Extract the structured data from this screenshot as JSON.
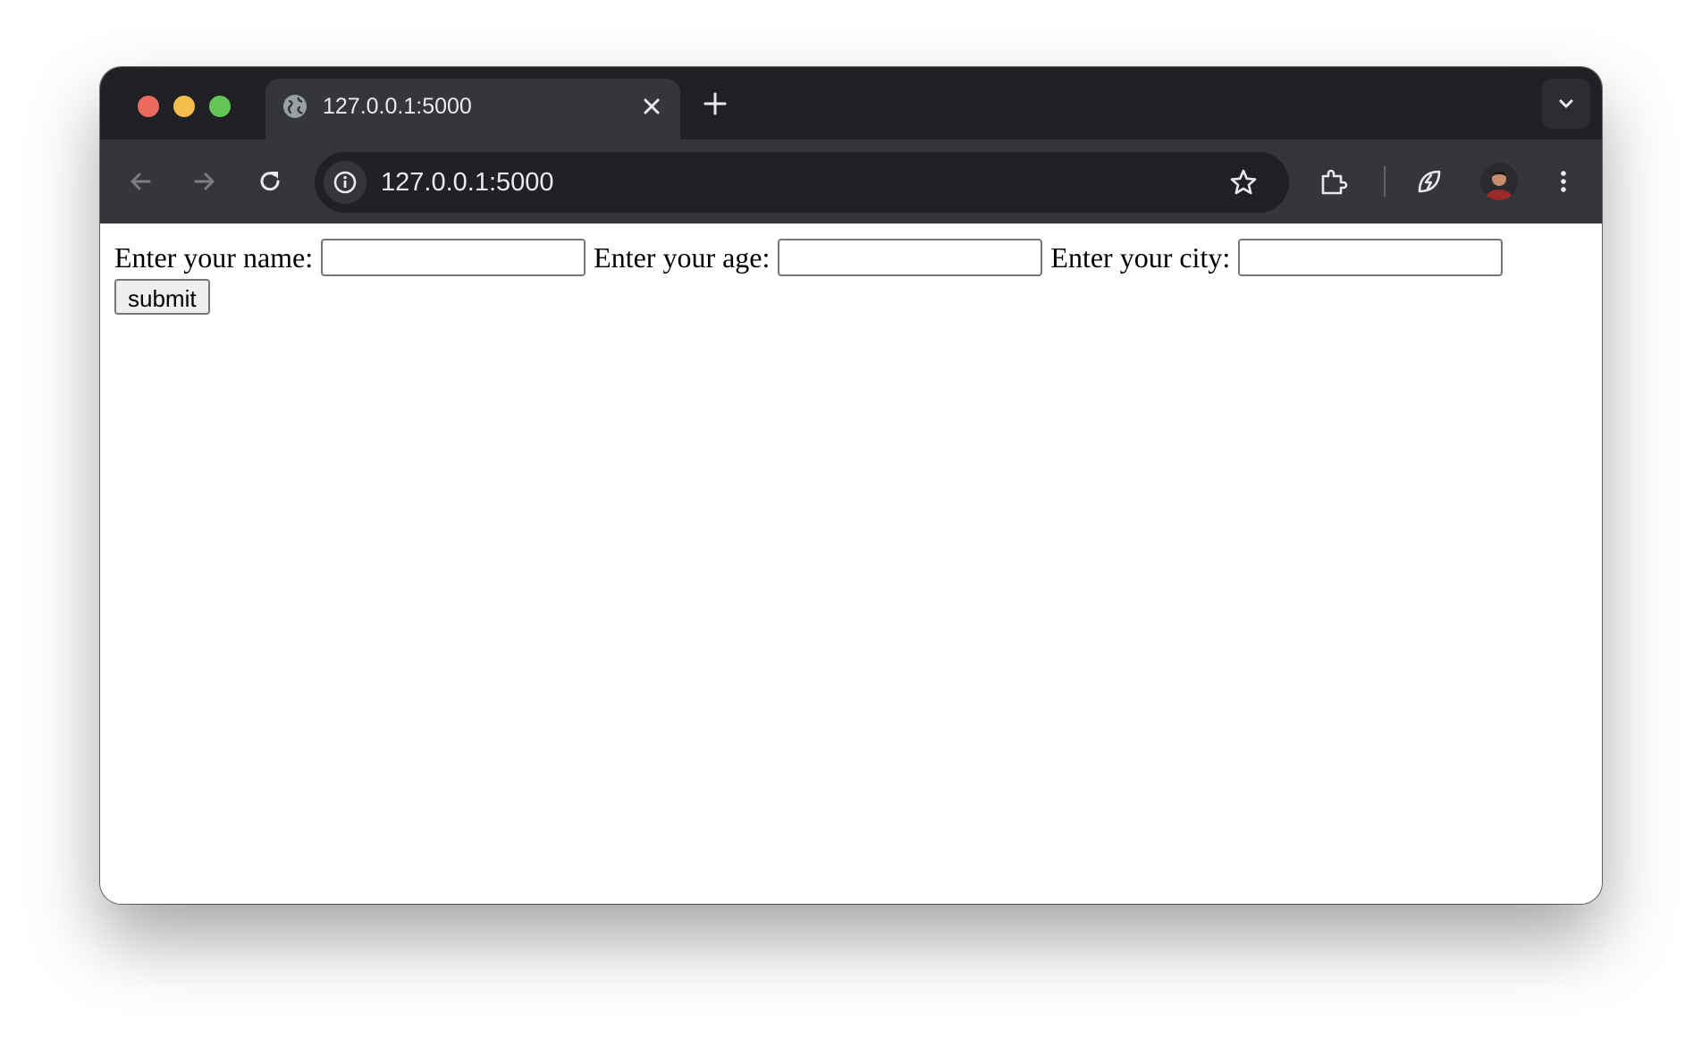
{
  "browser": {
    "tab": {
      "title": "127.0.0.1:5000"
    },
    "address_bar": {
      "url": "127.0.0.1:5000"
    }
  },
  "form": {
    "name_label": "Enter your name:",
    "name_value": "",
    "age_label": "Enter your age:",
    "age_value": "",
    "city_label": "Enter your city:",
    "city_value": "",
    "submit_label": "submit"
  },
  "colors": {
    "chrome_dark": "#202124",
    "chrome_toolbar": "#35363a",
    "close_red": "#ed6a5e",
    "minimize_yellow": "#f5bf4f",
    "zoom_green": "#62c554"
  }
}
